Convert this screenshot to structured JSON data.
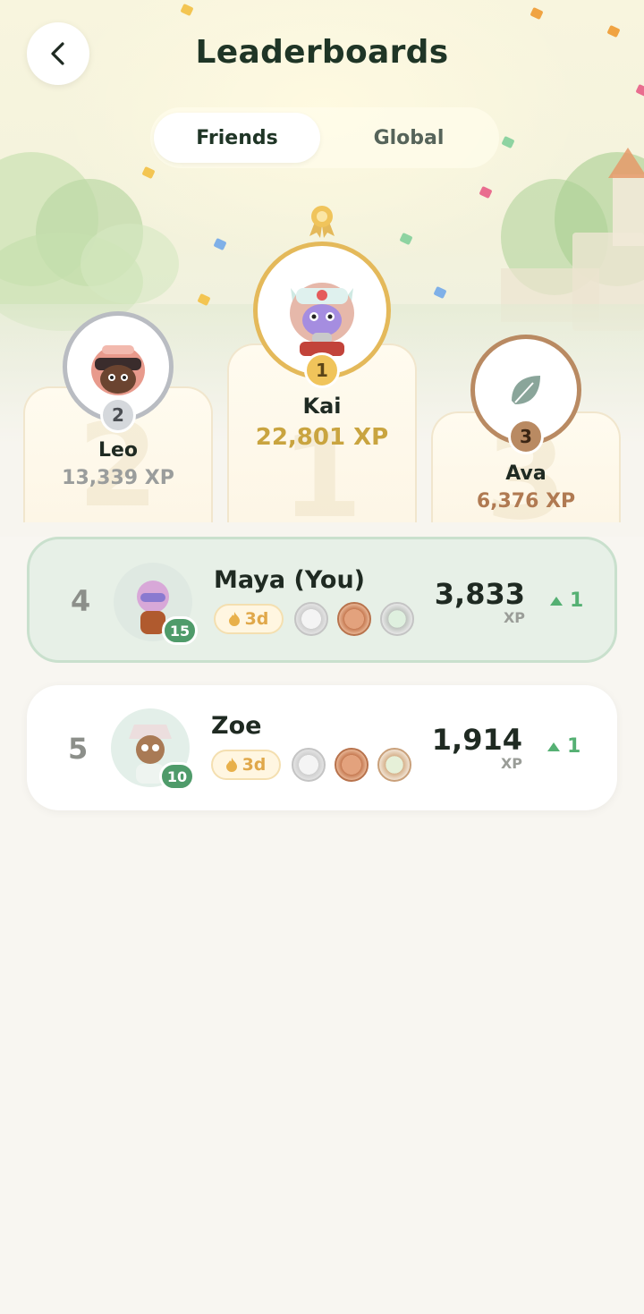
{
  "header": {
    "title": "Leaderboards"
  },
  "tabs": [
    {
      "label": "Friends",
      "active": true
    },
    {
      "label": "Global",
      "active": false
    }
  ],
  "podium": [
    {
      "rank": "2",
      "name": "Leo",
      "xp": "13,339 XP",
      "ring_color": "#b9bcc2",
      "xp_color": "#9a9d9c"
    },
    {
      "rank": "1",
      "name": "Kai",
      "xp": "22,801 XP",
      "ring_color": "#e4b95a",
      "xp_color": "#c9a43f"
    },
    {
      "rank": "3",
      "name": "Ava",
      "xp": "6,376 XP",
      "ring_color": "#b98a62",
      "xp_color": "#b07a52"
    }
  ],
  "rows": [
    {
      "rank": "4",
      "name": "Maya (You)",
      "level": "15",
      "streak": "3d",
      "xp": "3,833",
      "xp_unit": "XP",
      "delta": "1",
      "highlight": true
    },
    {
      "rank": "5",
      "name": "Zoe",
      "level": "10",
      "streak": "3d",
      "xp": "1,914",
      "xp_unit": "XP",
      "delta": "1",
      "highlight": false
    }
  ],
  "icons": {
    "back": "chevron-left-icon",
    "first_place_ribbon": "medal-ribbon-icon",
    "ava_avatar": "leaf-icon",
    "streak": "flame-icon",
    "medals": [
      "silver-trophy-medal-icon",
      "bronze-medal-icon",
      "calendar-check-medal-icon"
    ]
  },
  "colors": {
    "accent_green": "#4f9b6a",
    "delta_green": "#55b073",
    "gold": "#e4b95a",
    "silver": "#b9bcc2",
    "bronze": "#b98a62"
  }
}
